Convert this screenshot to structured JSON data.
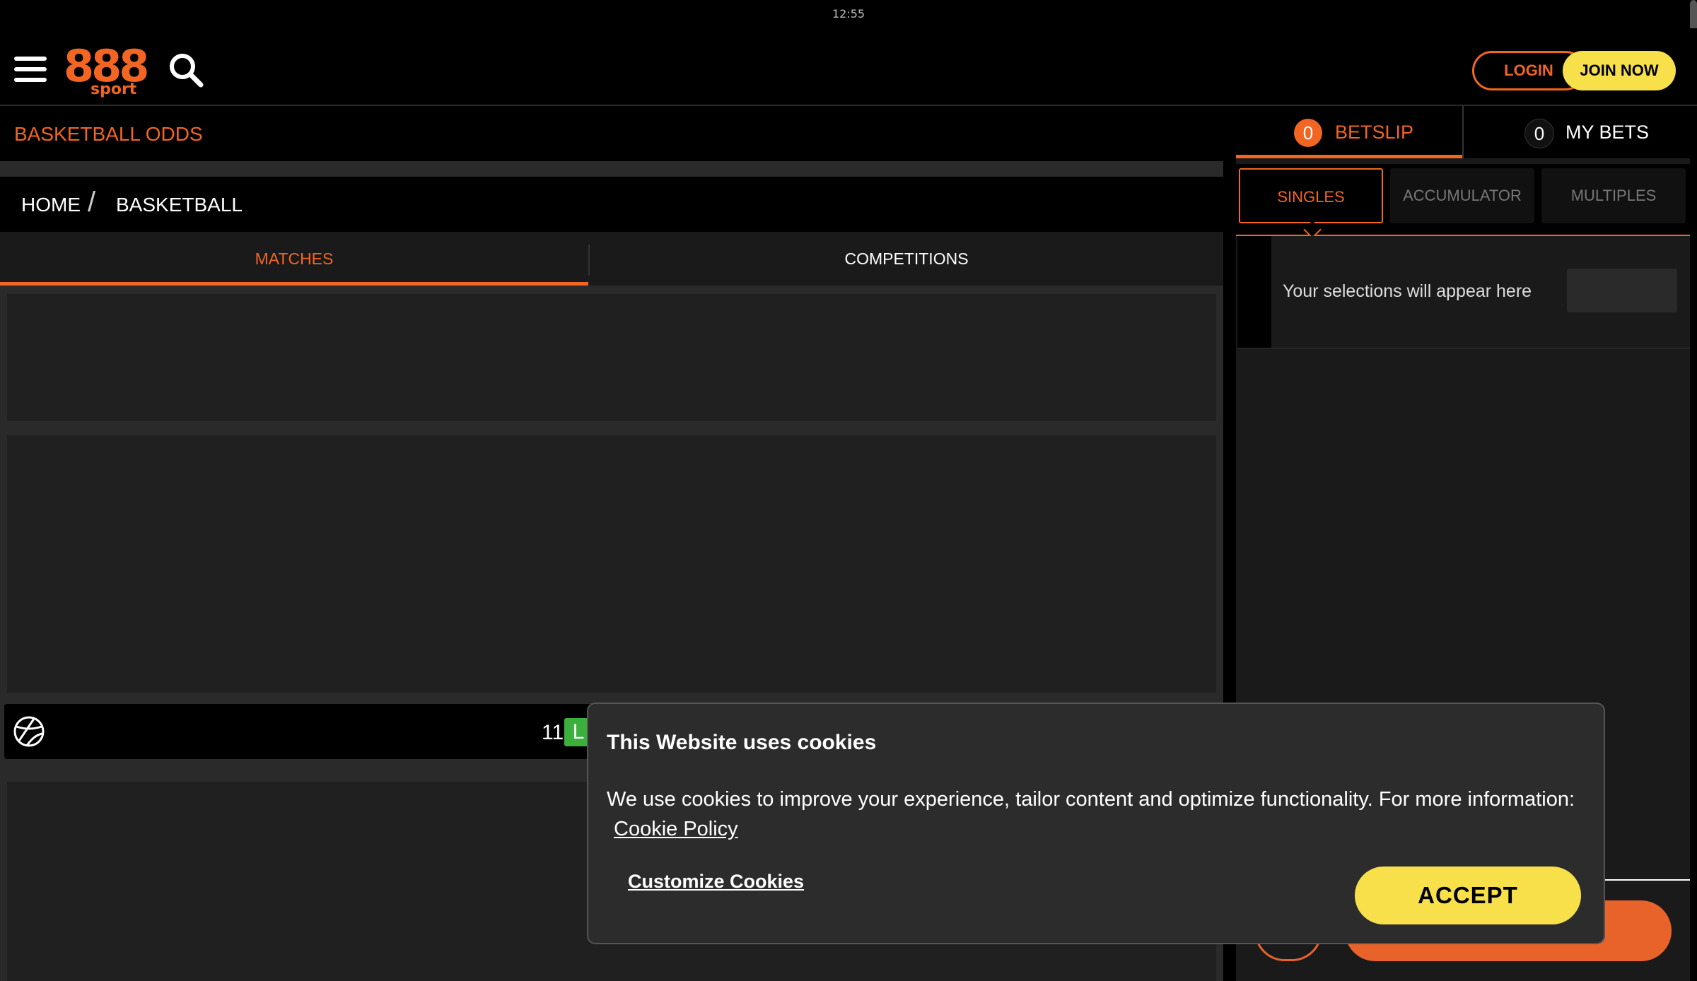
{
  "status_bar": {
    "time": "12:55"
  },
  "header": {
    "logo_text": "888",
    "logo_sub": "sport",
    "login_label": "LOGIN",
    "join_label": "JOIN NOW"
  },
  "page": {
    "title": "BASKETBALL ODDS"
  },
  "breadcrumb": {
    "home": "HOME",
    "separator": "/",
    "current": "BASKETBALL"
  },
  "tabs": {
    "matches": "MATCHES",
    "competitions": "COMPETITIONS"
  },
  "event_row": {
    "number": "11",
    "live_badge": "L"
  },
  "betslip": {
    "betslip_count": "0",
    "betslip_label": "BETSLIP",
    "mybets_count": "0",
    "mybets_label": "MY BETS",
    "types": {
      "singles": "SINGLES",
      "accumulator": "ACCUMULATOR",
      "multiples": "MULTIPLES"
    },
    "empty_message": "Your selections will appear here"
  },
  "cookie_banner": {
    "title": "This Website uses cookies",
    "message": "We use cookies to improve your experience, tailor content and optimize functionality. For more information:",
    "policy_link": "Cookie Policy",
    "customize_label": "Customize Cookies",
    "accept_label": "ACCEPT"
  },
  "colors": {
    "brand": "#f26522",
    "accent_yellow": "#f8e04a",
    "live_green": "#3cb03c"
  }
}
